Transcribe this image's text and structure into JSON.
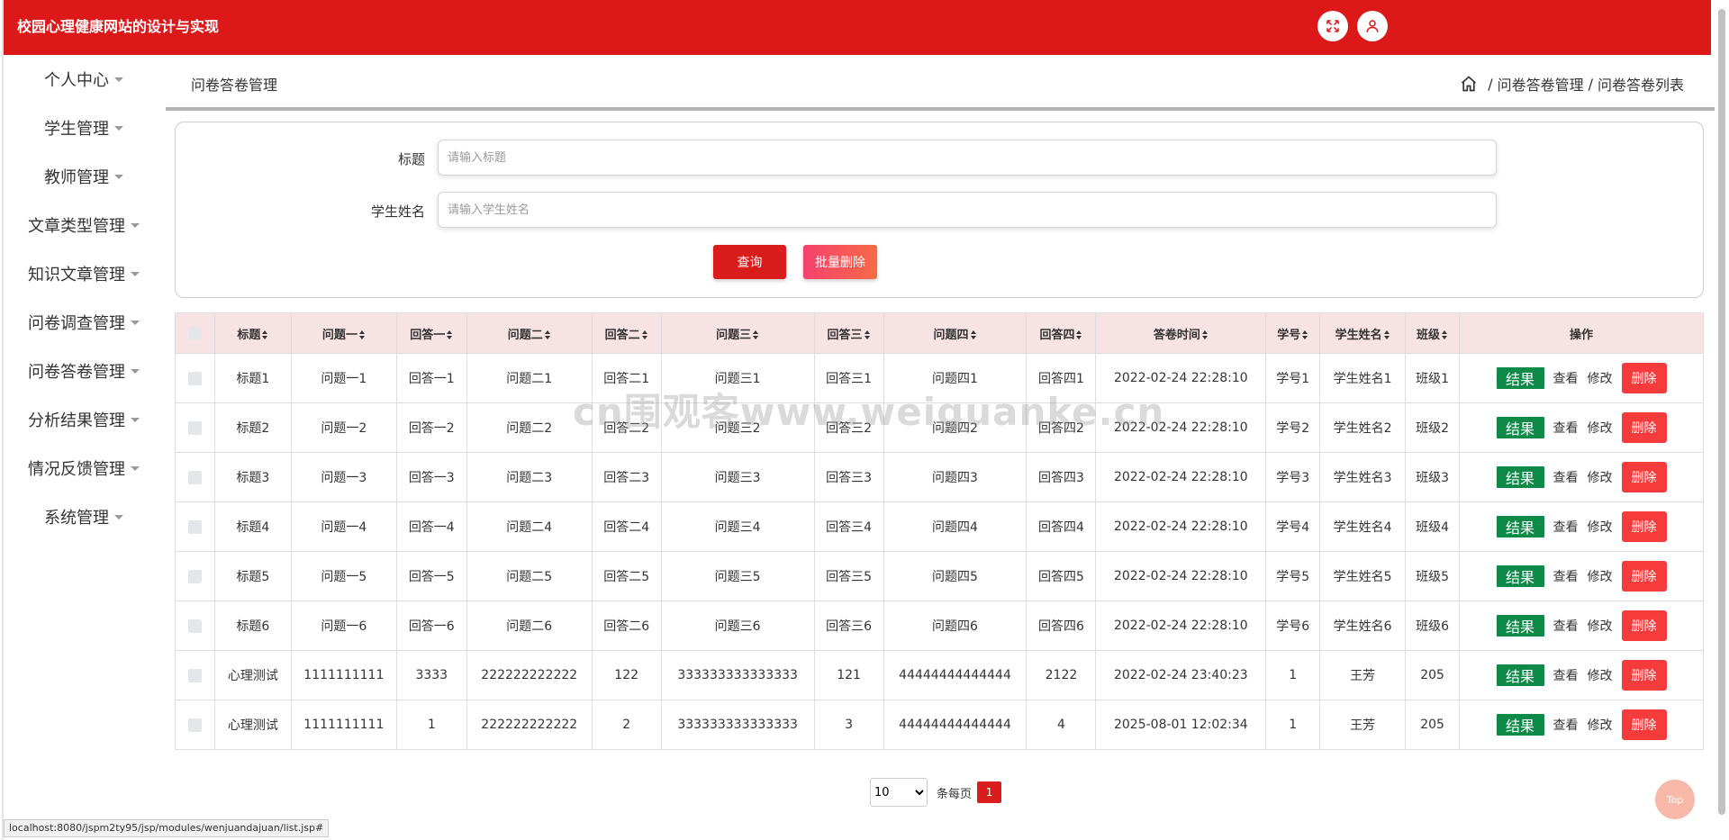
{
  "header": {
    "title": "校园心理健康网站的设计与实现",
    "icons": [
      "fullscreen-icon",
      "user-icon"
    ]
  },
  "sidebar": {
    "items": [
      {
        "label": "个人中心"
      },
      {
        "label": "学生管理"
      },
      {
        "label": "教师管理"
      },
      {
        "label": "文章类型管理"
      },
      {
        "label": "知识文章管理"
      },
      {
        "label": "问卷调查管理"
      },
      {
        "label": "问卷答卷管理"
      },
      {
        "label": "分析结果管理"
      },
      {
        "label": "情况反馈管理"
      },
      {
        "label": "系统管理"
      }
    ]
  },
  "breadcrumb": {
    "page_title": "问卷答卷管理",
    "sep": "/",
    "level1": "问卷答卷管理",
    "level2": "问卷答卷列表"
  },
  "search": {
    "title_label": "标题",
    "title_placeholder": "请输入标题",
    "name_label": "学生姓名",
    "name_placeholder": "请输入学生姓名",
    "query_label": "查询",
    "batch_delete_label": "批量删除"
  },
  "table": {
    "columns": [
      "标题",
      "问题一",
      "回答一",
      "问题二",
      "回答二",
      "问题三",
      "回答三",
      "问题四",
      "回答四",
      "答卷时间",
      "学号",
      "学生姓名",
      "班级",
      "操作"
    ],
    "rows": [
      [
        "标题1",
        "问题一1",
        "回答一1",
        "问题二1",
        "回答二1",
        "问题三1",
        "回答三1",
        "问题四1",
        "回答四1",
        "2022-02-24 22:28:10",
        "学号1",
        "学生姓名1",
        "班级1"
      ],
      [
        "标题2",
        "问题一2",
        "回答一2",
        "问题二2",
        "回答二2",
        "问题三2",
        "回答三2",
        "问题四2",
        "回答四2",
        "2022-02-24 22:28:10",
        "学号2",
        "学生姓名2",
        "班级2"
      ],
      [
        "标题3",
        "问题一3",
        "回答一3",
        "问题二3",
        "回答二3",
        "问题三3",
        "回答三3",
        "问题四3",
        "回答四3",
        "2022-02-24 22:28:10",
        "学号3",
        "学生姓名3",
        "班级3"
      ],
      [
        "标题4",
        "问题一4",
        "回答一4",
        "问题二4",
        "回答二4",
        "问题三4",
        "回答三4",
        "问题四4",
        "回答四4",
        "2022-02-24 22:28:10",
        "学号4",
        "学生姓名4",
        "班级4"
      ],
      [
        "标题5",
        "问题一5",
        "回答一5",
        "问题二5",
        "回答二5",
        "问题三5",
        "回答三5",
        "问题四5",
        "回答四5",
        "2022-02-24 22:28:10",
        "学号5",
        "学生姓名5",
        "班级5"
      ],
      [
        "标题6",
        "问题一6",
        "回答一6",
        "问题二6",
        "回答二6",
        "问题三6",
        "回答三6",
        "问题四6",
        "回答四6",
        "2022-02-24 22:28:10",
        "学号6",
        "学生姓名6",
        "班级6"
      ],
      [
        "心理测试",
        "1111111111",
        "3333",
        "222222222222",
        "122",
        "333333333333333",
        "121",
        "44444444444444",
        "2122",
        "2022-02-24 23:40:23",
        "1",
        "王芳",
        "205"
      ],
      [
        "心理测试",
        "1111111111",
        "1",
        "222222222222",
        "2",
        "333333333333333",
        "3",
        "44444444444444",
        "4",
        "2025-08-01 12:02:34",
        "1",
        "王芳",
        "205"
      ]
    ],
    "actions": {
      "result": "结果",
      "view": "查看",
      "edit": "修改",
      "delete": "删除"
    }
  },
  "pager": {
    "page_size": "10",
    "per_page_label": "条每页",
    "current_page": "1"
  },
  "top_button": "Top",
  "watermark": "cn围观客www.weiguanke.cn",
  "statusbar": "localhost:8080/jspm2ty95/jsp/modules/wenjuandajuan/list.jsp#",
  "colors": {
    "header_bg": "#dc1818",
    "primary": "#d91c1c",
    "result_btn": "#0d8a48",
    "delete_btn": "#f53b3b",
    "table_header_bg": "#f7e3e3"
  }
}
